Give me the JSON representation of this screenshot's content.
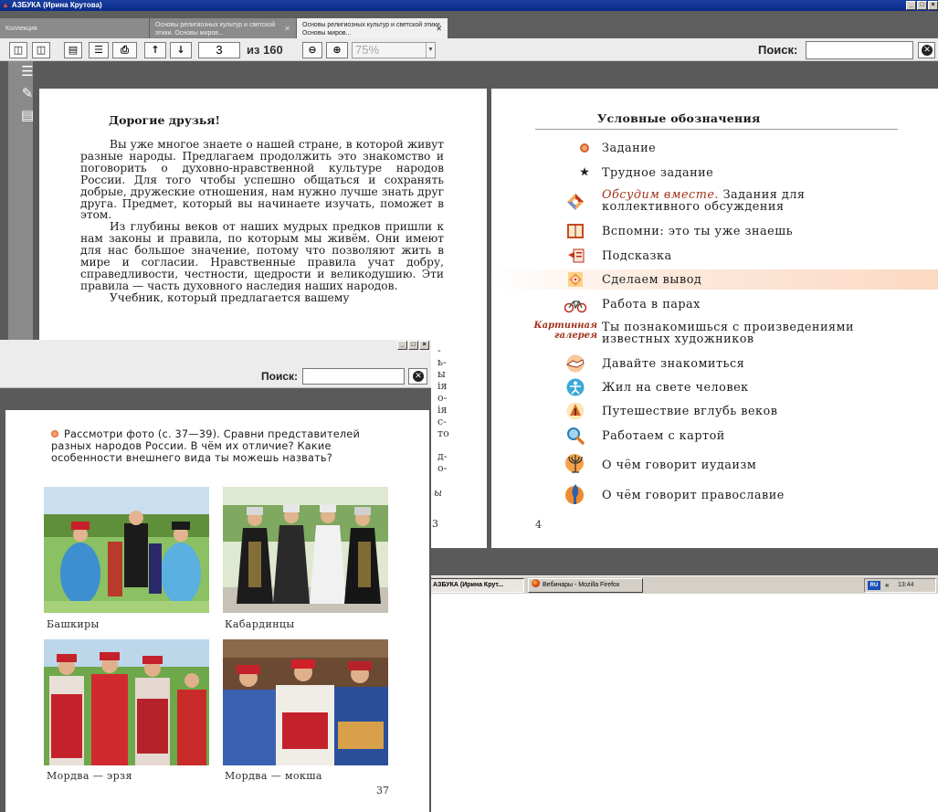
{
  "window": {
    "title": "АЗБУКА (Ирина Крутова)",
    "buttons": [
      "_",
      "□",
      "×"
    ]
  },
  "tabs": [
    {
      "label": "Коллекция"
    },
    {
      "label": "Основы религиозных культур и светской этики. Основы миров..."
    },
    {
      "label": "Основы религиозных культур и светской этики. Основы миров..."
    }
  ],
  "toolbar": {
    "page_value": "3",
    "page_total": "из 160",
    "zoom_value": "75%",
    "search_label": "Поиск:",
    "search_value": ""
  },
  "left_page": {
    "title": "Дорогие друзья!",
    "paragraphs": [
      "Вы уже многое знаете о нашей стране, в которой живут разные народы. Предлагаем продолжить это знакомство и поговорить о духовно-нравственной культуре народов России. Для того чтобы успешно общаться и сохранять добрые, дружеские отношения, нам нужно лучше знать друг друга. Предмет, который вы начинаете изучать, поможет в этом.",
      "Из глубины веков от наших мудрых предков пришли к нам законы и правила, по которым мы живём. Они имеют для нас большое значение, потому что позволяют жить в мире и согласии. Нравственные правила учат добру, справедливости, честности, щедрости и великодушию. Эти правила — часть духовного наследия наших народов.",
      "Учебник, который предлагается вашему"
    ],
    "fragments": [
      "-",
      "ь-",
      "ы",
      "ія",
      "о-",
      "ія",
      "с-",
      "то",
      "д-",
      "о-"
    ],
    "italic_fragment": "ы",
    "page_number": "3"
  },
  "right_page": {
    "title": "Условные обозначения",
    "legend": [
      {
        "icon": "orange-dot-icon",
        "text": "Задание"
      },
      {
        "icon": "star-icon",
        "text": "Трудное задание"
      },
      {
        "icon": "discuss-together-icon",
        "em": "Обсудим вместе.",
        "text": " Задания для коллективного обсуждения"
      },
      {
        "icon": "book-icon",
        "text": "Вспомни: это ты уже знаешь"
      },
      {
        "icon": "hint-icon",
        "text": "Подсказка"
      },
      {
        "icon": "conclusion-icon",
        "text": "Сделаем вывод"
      },
      {
        "icon": "bicycle-icon",
        "text": "Работа в парах"
      },
      {
        "icon": "gallery-label",
        "label": "Картинная галерея",
        "text": "Ты познакомишься с произведениями известных художников"
      },
      {
        "icon": "handshake-icon",
        "text": "Давайте знакомиться"
      },
      {
        "icon": "person-icon",
        "text": "Жил на свете человек"
      },
      {
        "icon": "journey-icon",
        "text": "Путешествие вглубь веков"
      },
      {
        "icon": "magnifier-icon",
        "text": "Работаем с картой"
      },
      {
        "icon": "menorah-icon",
        "text": "О чём говорит иудаизм"
      },
      {
        "icon": "church-icon",
        "text": "О чём говорит православие"
      }
    ],
    "page_number": "4"
  },
  "taskbar": {
    "items": [
      "АЗБУКА (Ирина Крут...",
      "Вебинары - Mozilla Firefox"
    ],
    "lang": "RU",
    "arrow": "«",
    "clock": "13:44"
  },
  "overlay": {
    "search_label": "Поиск:",
    "task_text": "Рассмотри фото (с. 37—39). Сравни представителей разных народов России. В чём их отличие? Какие особенности внешнего вида ты можешь назвать?",
    "photos": [
      {
        "caption": "Башкиры"
      },
      {
        "caption": "Кабардинцы"
      },
      {
        "caption": "Мордва — эрзя"
      },
      {
        "caption": "Мордва — мокша"
      }
    ],
    "page_number": "37"
  },
  "colors": {
    "accent": "#a33318",
    "highlight": "#fbd9c3",
    "window_title": "#0b2a86",
    "reader_bg": "#5a5a5a"
  }
}
